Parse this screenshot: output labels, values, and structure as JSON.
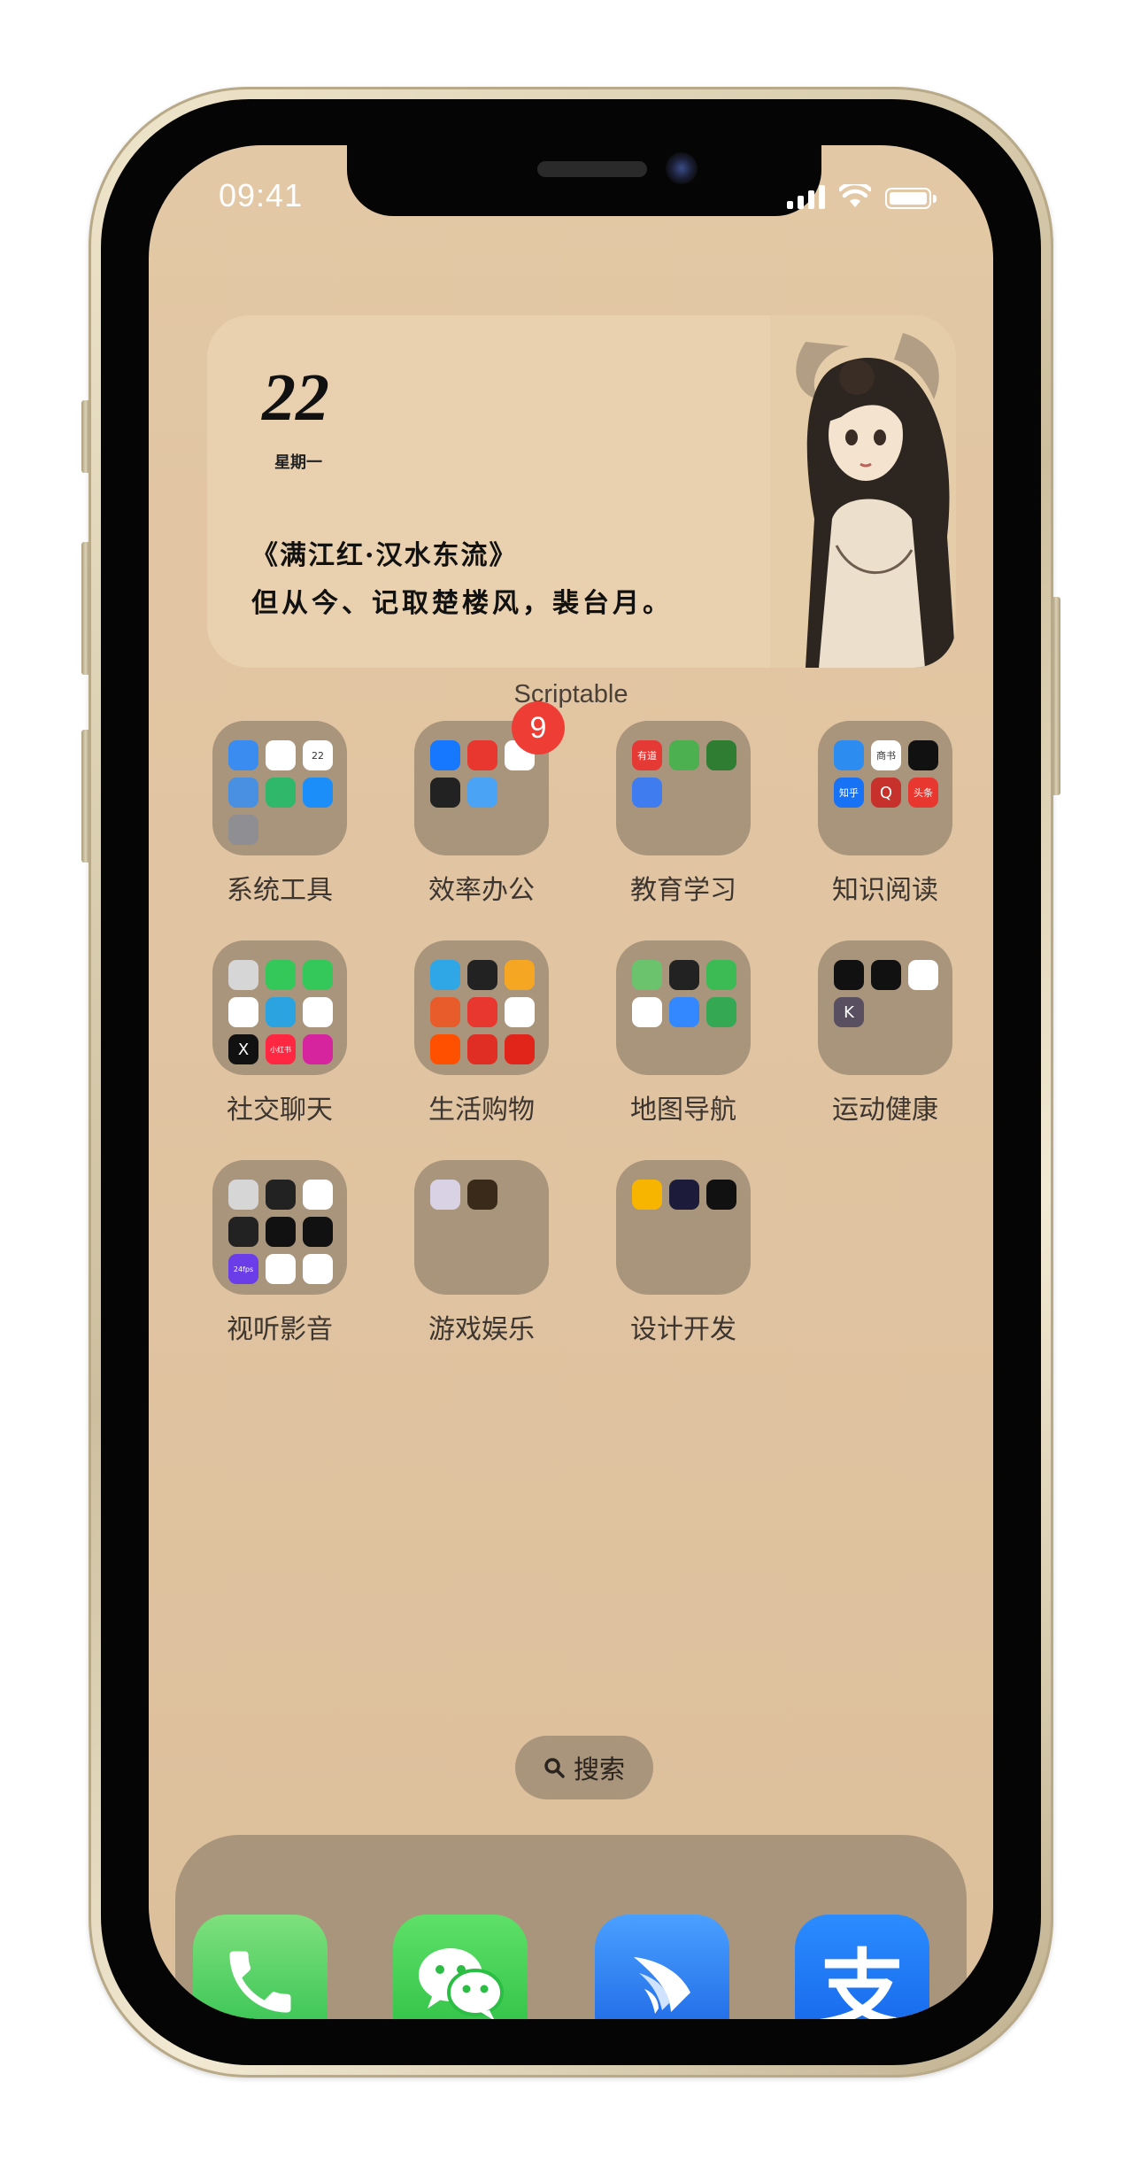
{
  "status_bar": {
    "time": "09:41"
  },
  "widget": {
    "day": "22",
    "weekday": "星期一",
    "poem_title": "《满江红·汉水东流》",
    "poem_line": "但从今、记取楚楼风，裴台月。",
    "caption": "Scriptable"
  },
  "folders": [
    {
      "label": "系统工具",
      "badge": null,
      "apps": [
        {
          "icon": "safari-icon",
          "color": "#3b8cf1"
        },
        {
          "icon": "clock-icon",
          "color": "#ffffff"
        },
        {
          "icon": "calendar-icon",
          "color": "#ffffff",
          "text": "22"
        },
        {
          "icon": "weather-icon",
          "color": "#4a90e2"
        },
        {
          "icon": "mi-home-icon",
          "color": "#2fb86a"
        },
        {
          "icon": "app-store-icon",
          "color": "#1c8ef9"
        },
        {
          "icon": "settings-icon",
          "color": "#8e8e93"
        }
      ]
    },
    {
      "label": "效率办公",
      "badge": "9",
      "apps": [
        {
          "icon": "dingtalk-icon",
          "color": "#1677ff"
        },
        {
          "icon": "mindmap-icon",
          "color": "#e8372f"
        },
        {
          "icon": "todo-icon",
          "color": "#ffffff"
        },
        {
          "icon": "wps-icon",
          "color": "#222222"
        },
        {
          "icon": "cloud-drive-icon",
          "color": "#4aa3f5"
        }
      ]
    },
    {
      "label": "教育学习",
      "badge": null,
      "apps": [
        {
          "icon": "youdao-icon",
          "color": "#e53935",
          "text": "有道"
        },
        {
          "icon": "duolingo-icon",
          "color": "#4caf50"
        },
        {
          "icon": "video-course-icon",
          "color": "#2e7d32"
        },
        {
          "icon": "notes-icon",
          "color": "#3f7cf0"
        }
      ]
    },
    {
      "label": "知识阅读",
      "badge": null,
      "apps": [
        {
          "icon": "books-icon",
          "color": "#2d8cf0"
        },
        {
          "icon": "wechat-read-icon",
          "color": "#ffffff",
          "text": "商书"
        },
        {
          "icon": "medium-icon",
          "color": "#111111"
        },
        {
          "icon": "zhihu-icon",
          "color": "#1772f6",
          "text": "知乎"
        },
        {
          "icon": "quora-icon",
          "color": "#c7312c",
          "text": "Q"
        },
        {
          "icon": "toutiao-icon",
          "color": "#e8372f",
          "text": "头条"
        }
      ]
    },
    {
      "label": "社交聊天",
      "badge": null,
      "apps": [
        {
          "icon": "contacts-icon",
          "color": "#d6d6d6"
        },
        {
          "icon": "messages-icon",
          "color": "#34c759"
        },
        {
          "icon": "facetime-icon",
          "color": "#34c759"
        },
        {
          "icon": "qq-icon",
          "color": "#ffffff"
        },
        {
          "icon": "telegram-icon",
          "color": "#2aa3e0"
        },
        {
          "icon": "weibo-icon",
          "color": "#ffffff"
        },
        {
          "icon": "x-icon",
          "color": "#111111",
          "text": "X"
        },
        {
          "icon": "xiaohongshu-icon",
          "color": "#ff2741",
          "text": "小红书"
        },
        {
          "icon": "instagram-icon",
          "color": "#d6249f"
        }
      ]
    },
    {
      "label": "生活购物",
      "badge": null,
      "apps": [
        {
          "icon": "alipay-mini-icon",
          "color": "#2fa6e6"
        },
        {
          "icon": "wallet-icon",
          "color": "#222222"
        },
        {
          "icon": "store-icon",
          "color": "#f5a623"
        },
        {
          "icon": "meituan-icon",
          "color": "#e85c2c"
        },
        {
          "icon": "dianping-icon",
          "color": "#e8372f"
        },
        {
          "icon": "xianyu-icon",
          "color": "#ffffff"
        },
        {
          "icon": "taobao-icon",
          "color": "#ff5000"
        },
        {
          "icon": "pinduoduo-icon",
          "color": "#e02e24"
        },
        {
          "icon": "jd-icon",
          "color": "#e1251b"
        }
      ]
    },
    {
      "label": "地图导航",
      "badge": null,
      "apps": [
        {
          "icon": "maps-icon",
          "color": "#6bc46d"
        },
        {
          "icon": "find-my-icon",
          "color": "#222222"
        },
        {
          "icon": "amap-icon",
          "color": "#3cba54"
        },
        {
          "icon": "didi-icon",
          "color": "#ffffff"
        },
        {
          "icon": "baidu-map-icon",
          "color": "#3388ff"
        },
        {
          "icon": "metro-icon",
          "color": "#34a853"
        }
      ]
    },
    {
      "label": "运动健康",
      "badge": null,
      "apps": [
        {
          "icon": "watch-icon",
          "color": "#111111"
        },
        {
          "icon": "fitness-icon",
          "color": "#111111"
        },
        {
          "icon": "health-icon",
          "color": "#ffffff"
        },
        {
          "icon": "keep-icon",
          "color": "#584f60",
          "text": "K"
        }
      ]
    },
    {
      "label": "视听影音",
      "badge": null,
      "apps": [
        {
          "icon": "camera-icon",
          "color": "#d6d6d6"
        },
        {
          "icon": "camera-lens-icon",
          "color": "#222222"
        },
        {
          "icon": "photos-icon",
          "color": "#ffffff"
        },
        {
          "icon": "record-icon",
          "color": "#222222"
        },
        {
          "icon": "circle-cam-icon",
          "color": "#111111"
        },
        {
          "icon": "capcut-icon",
          "color": "#111111"
        },
        {
          "icon": "fps-icon",
          "color": "#6a3de8",
          "text": "24fps"
        },
        {
          "icon": "music-wave-icon",
          "color": "#ffffff"
        },
        {
          "icon": "photo-editor-icon",
          "color": "#ffffff"
        }
      ]
    },
    {
      "label": "游戏娱乐",
      "badge": null,
      "apps": [
        {
          "icon": "genshin-icon",
          "color": "#d9d2e4"
        },
        {
          "icon": "star-rail-icon",
          "color": "#3a2a1a"
        }
      ]
    },
    {
      "label": "设计开发",
      "badge": null,
      "apps": [
        {
          "icon": "sketch-icon",
          "color": "#f7b500"
        },
        {
          "icon": "swift-playgrounds-icon",
          "color": "#1c1c3a"
        },
        {
          "icon": "shortcuts-icon",
          "color": "#111111"
        }
      ]
    }
  ],
  "search": {
    "label": "搜索"
  },
  "dock": [
    {
      "name": "phone-app",
      "color": "#4cd964"
    },
    {
      "name": "wechat-app",
      "color": "#3fbf4a"
    },
    {
      "name": "feishu-app",
      "color": "#2c7df2"
    },
    {
      "name": "alipay-app",
      "color": "#1677ff",
      "text": "支"
    }
  ]
}
